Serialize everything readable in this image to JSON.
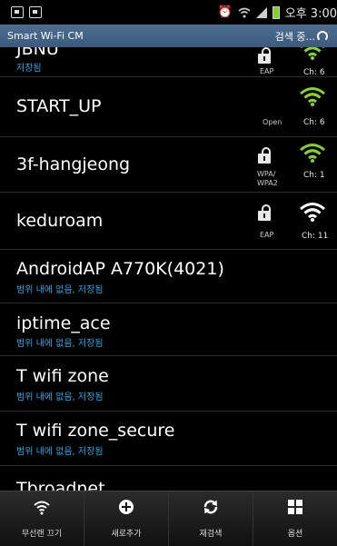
{
  "status_bar": {
    "time": "오후 3:00"
  },
  "title_bar": {
    "title": "Smart Wi-Fi CM",
    "status": "검색 중..."
  },
  "networks": [
    {
      "ssid": "JBNU",
      "subtitle": "저장됨",
      "security": "EAP",
      "channel": "Ch: 6",
      "locked": true,
      "in_range": true,
      "signal_color": "#8bd126"
    },
    {
      "ssid": "START_UP",
      "subtitle": "",
      "security": "Open",
      "channel": "Ch: 6",
      "locked": false,
      "in_range": true,
      "signal_color": "#8bd126"
    },
    {
      "ssid": "3f-hangjeong",
      "subtitle": "",
      "security": "WPA/\nWPA2",
      "channel": "Ch: 1",
      "locked": true,
      "in_range": true,
      "signal_color": "#8bd126"
    },
    {
      "ssid": "keduroam",
      "subtitle": "",
      "security": "EAP",
      "channel": "Ch: 11",
      "locked": true,
      "in_range": true,
      "signal_color": "#ffffff"
    },
    {
      "ssid": "AndroidAP A770K(4021)",
      "subtitle": "범위 내에 없음, 저장됨",
      "in_range": false
    },
    {
      "ssid": "iptime_ace",
      "subtitle": "범위 내에 없음, 저장됨",
      "in_range": false
    },
    {
      "ssid": "T wifi zone",
      "subtitle": "범위 내에 없음, 저장됨",
      "in_range": false
    },
    {
      "ssid": "T wifi zone_secure",
      "subtitle": "범위 내에 없음, 저장됨",
      "in_range": false
    },
    {
      "ssid": "Tbroadnet",
      "subtitle": "",
      "in_range": false
    }
  ],
  "bottom_nav": [
    {
      "label": "무선랜 끄기",
      "icon": "wifi-icon"
    },
    {
      "label": "새로추가",
      "icon": "plus-circle-icon"
    },
    {
      "label": "재검색",
      "icon": "refresh-icon"
    },
    {
      "label": "옵션",
      "icon": "grid-icon"
    }
  ],
  "colors": {
    "title_bar": "#45668a",
    "accent_blue": "#2da8e6",
    "signal_green": "#8bd126"
  }
}
